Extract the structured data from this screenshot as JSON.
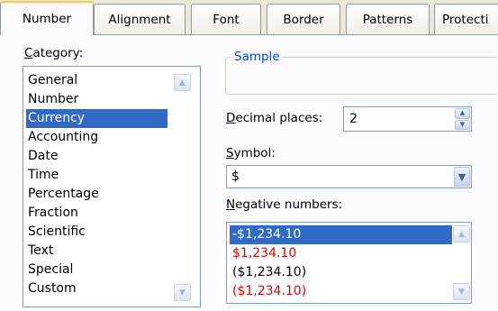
{
  "tabs": [
    {
      "label": "Number"
    },
    {
      "label": "Alignment"
    },
    {
      "label": "Font"
    },
    {
      "label": "Border"
    },
    {
      "label": "Patterns"
    },
    {
      "label": "Protecti"
    }
  ],
  "category": {
    "label_prefix": "C",
    "label_rest": "ategory:",
    "items": [
      {
        "label": "General"
      },
      {
        "label": "Number"
      },
      {
        "label": "Currency"
      },
      {
        "label": "Accounting"
      },
      {
        "label": "Date"
      },
      {
        "label": "Time"
      },
      {
        "label": "Percentage"
      },
      {
        "label": "Fraction"
      },
      {
        "label": "Scientific"
      },
      {
        "label": "Text"
      },
      {
        "label": "Special"
      },
      {
        "label": "Custom"
      }
    ],
    "selected": "Currency"
  },
  "sample": {
    "legend": "Sample"
  },
  "decimal": {
    "label_prefix": "D",
    "label_rest": "ecimal places:",
    "value": "2"
  },
  "symbol": {
    "label_prefix": "S",
    "label_rest": "ymbol:",
    "value": "$"
  },
  "negative": {
    "label_prefix": "N",
    "label_rest": "egative numbers:",
    "items": [
      {
        "label": "-$1,234.10"
      },
      {
        "label": "$1,234.10"
      },
      {
        "label": "($1,234.10)"
      },
      {
        "label": "($1,234.10)"
      }
    ],
    "colors": {
      "normal": "#000000",
      "red": "#e00000",
      "selected_bg": "#316ac5"
    }
  },
  "icons": {
    "scroll_up": "▲",
    "scroll_down": "▼",
    "spin_up": "▲",
    "spin_down": "▼",
    "dropdown": "▼"
  }
}
